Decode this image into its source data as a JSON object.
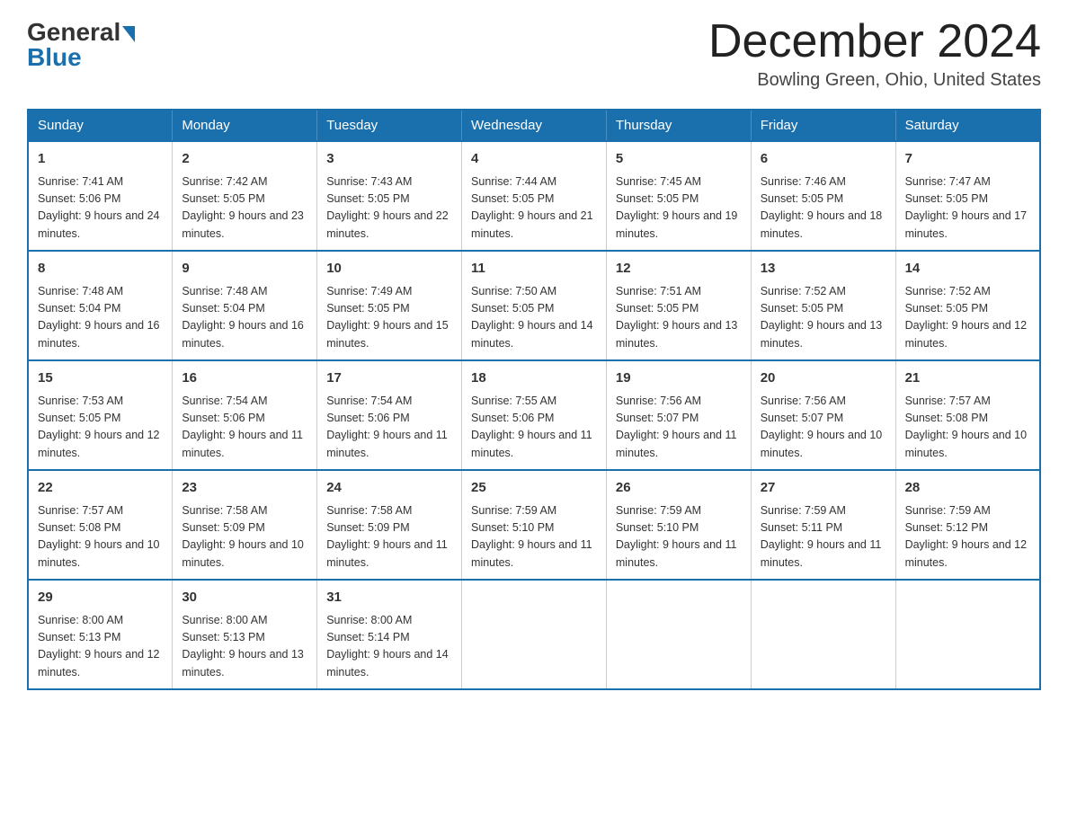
{
  "logo": {
    "general": "General",
    "blue": "Blue"
  },
  "title": {
    "month_year": "December 2024",
    "location": "Bowling Green, Ohio, United States"
  },
  "days_of_week": [
    "Sunday",
    "Monday",
    "Tuesday",
    "Wednesday",
    "Thursday",
    "Friday",
    "Saturday"
  ],
  "weeks": [
    [
      {
        "day": "1",
        "sunrise": "Sunrise: 7:41 AM",
        "sunset": "Sunset: 5:06 PM",
        "daylight": "Daylight: 9 hours and 24 minutes."
      },
      {
        "day": "2",
        "sunrise": "Sunrise: 7:42 AM",
        "sunset": "Sunset: 5:05 PM",
        "daylight": "Daylight: 9 hours and 23 minutes."
      },
      {
        "day": "3",
        "sunrise": "Sunrise: 7:43 AM",
        "sunset": "Sunset: 5:05 PM",
        "daylight": "Daylight: 9 hours and 22 minutes."
      },
      {
        "day": "4",
        "sunrise": "Sunrise: 7:44 AM",
        "sunset": "Sunset: 5:05 PM",
        "daylight": "Daylight: 9 hours and 21 minutes."
      },
      {
        "day": "5",
        "sunrise": "Sunrise: 7:45 AM",
        "sunset": "Sunset: 5:05 PM",
        "daylight": "Daylight: 9 hours and 19 minutes."
      },
      {
        "day": "6",
        "sunrise": "Sunrise: 7:46 AM",
        "sunset": "Sunset: 5:05 PM",
        "daylight": "Daylight: 9 hours and 18 minutes."
      },
      {
        "day": "7",
        "sunrise": "Sunrise: 7:47 AM",
        "sunset": "Sunset: 5:05 PM",
        "daylight": "Daylight: 9 hours and 17 minutes."
      }
    ],
    [
      {
        "day": "8",
        "sunrise": "Sunrise: 7:48 AM",
        "sunset": "Sunset: 5:04 PM",
        "daylight": "Daylight: 9 hours and 16 minutes."
      },
      {
        "day": "9",
        "sunrise": "Sunrise: 7:48 AM",
        "sunset": "Sunset: 5:04 PM",
        "daylight": "Daylight: 9 hours and 16 minutes."
      },
      {
        "day": "10",
        "sunrise": "Sunrise: 7:49 AM",
        "sunset": "Sunset: 5:05 PM",
        "daylight": "Daylight: 9 hours and 15 minutes."
      },
      {
        "day": "11",
        "sunrise": "Sunrise: 7:50 AM",
        "sunset": "Sunset: 5:05 PM",
        "daylight": "Daylight: 9 hours and 14 minutes."
      },
      {
        "day": "12",
        "sunrise": "Sunrise: 7:51 AM",
        "sunset": "Sunset: 5:05 PM",
        "daylight": "Daylight: 9 hours and 13 minutes."
      },
      {
        "day": "13",
        "sunrise": "Sunrise: 7:52 AM",
        "sunset": "Sunset: 5:05 PM",
        "daylight": "Daylight: 9 hours and 13 minutes."
      },
      {
        "day": "14",
        "sunrise": "Sunrise: 7:52 AM",
        "sunset": "Sunset: 5:05 PM",
        "daylight": "Daylight: 9 hours and 12 minutes."
      }
    ],
    [
      {
        "day": "15",
        "sunrise": "Sunrise: 7:53 AM",
        "sunset": "Sunset: 5:05 PM",
        "daylight": "Daylight: 9 hours and 12 minutes."
      },
      {
        "day": "16",
        "sunrise": "Sunrise: 7:54 AM",
        "sunset": "Sunset: 5:06 PM",
        "daylight": "Daylight: 9 hours and 11 minutes."
      },
      {
        "day": "17",
        "sunrise": "Sunrise: 7:54 AM",
        "sunset": "Sunset: 5:06 PM",
        "daylight": "Daylight: 9 hours and 11 minutes."
      },
      {
        "day": "18",
        "sunrise": "Sunrise: 7:55 AM",
        "sunset": "Sunset: 5:06 PM",
        "daylight": "Daylight: 9 hours and 11 minutes."
      },
      {
        "day": "19",
        "sunrise": "Sunrise: 7:56 AM",
        "sunset": "Sunset: 5:07 PM",
        "daylight": "Daylight: 9 hours and 11 minutes."
      },
      {
        "day": "20",
        "sunrise": "Sunrise: 7:56 AM",
        "sunset": "Sunset: 5:07 PM",
        "daylight": "Daylight: 9 hours and 10 minutes."
      },
      {
        "day": "21",
        "sunrise": "Sunrise: 7:57 AM",
        "sunset": "Sunset: 5:08 PM",
        "daylight": "Daylight: 9 hours and 10 minutes."
      }
    ],
    [
      {
        "day": "22",
        "sunrise": "Sunrise: 7:57 AM",
        "sunset": "Sunset: 5:08 PM",
        "daylight": "Daylight: 9 hours and 10 minutes."
      },
      {
        "day": "23",
        "sunrise": "Sunrise: 7:58 AM",
        "sunset": "Sunset: 5:09 PM",
        "daylight": "Daylight: 9 hours and 10 minutes."
      },
      {
        "day": "24",
        "sunrise": "Sunrise: 7:58 AM",
        "sunset": "Sunset: 5:09 PM",
        "daylight": "Daylight: 9 hours and 11 minutes."
      },
      {
        "day": "25",
        "sunrise": "Sunrise: 7:59 AM",
        "sunset": "Sunset: 5:10 PM",
        "daylight": "Daylight: 9 hours and 11 minutes."
      },
      {
        "day": "26",
        "sunrise": "Sunrise: 7:59 AM",
        "sunset": "Sunset: 5:10 PM",
        "daylight": "Daylight: 9 hours and 11 minutes."
      },
      {
        "day": "27",
        "sunrise": "Sunrise: 7:59 AM",
        "sunset": "Sunset: 5:11 PM",
        "daylight": "Daylight: 9 hours and 11 minutes."
      },
      {
        "day": "28",
        "sunrise": "Sunrise: 7:59 AM",
        "sunset": "Sunset: 5:12 PM",
        "daylight": "Daylight: 9 hours and 12 minutes."
      }
    ],
    [
      {
        "day": "29",
        "sunrise": "Sunrise: 8:00 AM",
        "sunset": "Sunset: 5:13 PM",
        "daylight": "Daylight: 9 hours and 12 minutes."
      },
      {
        "day": "30",
        "sunrise": "Sunrise: 8:00 AM",
        "sunset": "Sunset: 5:13 PM",
        "daylight": "Daylight: 9 hours and 13 minutes."
      },
      {
        "day": "31",
        "sunrise": "Sunrise: 8:00 AM",
        "sunset": "Sunset: 5:14 PM",
        "daylight": "Daylight: 9 hours and 14 minutes."
      },
      null,
      null,
      null,
      null
    ]
  ]
}
